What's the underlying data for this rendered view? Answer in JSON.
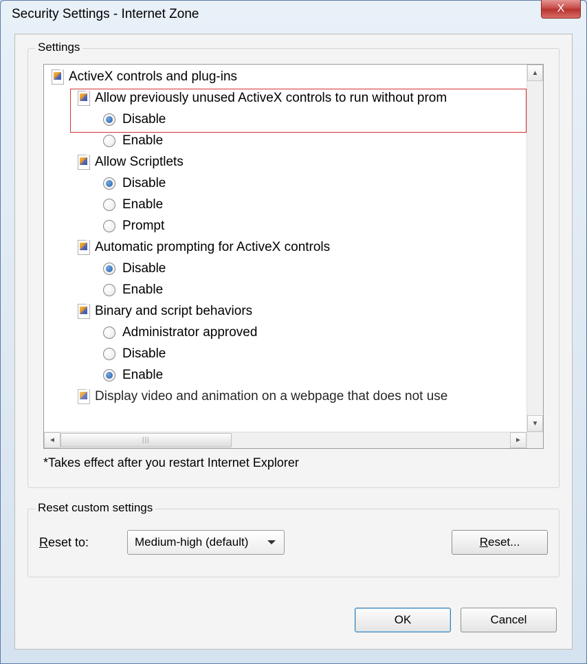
{
  "window": {
    "title": "Security Settings - Internet Zone",
    "close_glyph": "X"
  },
  "settings": {
    "groupbox_label": "Settings",
    "note": "*Takes effect after you restart Internet Explorer",
    "tree": [
      {
        "type": "category",
        "label": "ActiveX controls and plug-ins"
      },
      {
        "type": "subcategory",
        "label": "Allow previously unused ActiveX controls to run without prom"
      },
      {
        "type": "radio",
        "label": "Disable",
        "checked": true
      },
      {
        "type": "radio",
        "label": "Enable",
        "checked": false
      },
      {
        "type": "subcategory",
        "label": "Allow Scriptlets"
      },
      {
        "type": "radio",
        "label": "Disable",
        "checked": true
      },
      {
        "type": "radio",
        "label": "Enable",
        "checked": false
      },
      {
        "type": "radio",
        "label": "Prompt",
        "checked": false
      },
      {
        "type": "subcategory",
        "label": "Automatic prompting for ActiveX controls"
      },
      {
        "type": "radio",
        "label": "Disable",
        "checked": true
      },
      {
        "type": "radio",
        "label": "Enable",
        "checked": false
      },
      {
        "type": "subcategory",
        "label": "Binary and script behaviors"
      },
      {
        "type": "radio",
        "label": "Administrator approved",
        "checked": false
      },
      {
        "type": "radio",
        "label": "Disable",
        "checked": false
      },
      {
        "type": "radio",
        "label": "Enable",
        "checked": true
      },
      {
        "type": "subcategory_cut",
        "label": "Display video and animation on a webpage that does not use"
      }
    ]
  },
  "reset": {
    "groupbox_label": "Reset custom settings",
    "reset_to_prefix": "R",
    "reset_to_rest": "eset to:",
    "combo_value": "Medium-high (default)",
    "button_prefix": "R",
    "button_rest": "eset..."
  },
  "footer": {
    "ok": "OK",
    "cancel": "Cancel"
  }
}
